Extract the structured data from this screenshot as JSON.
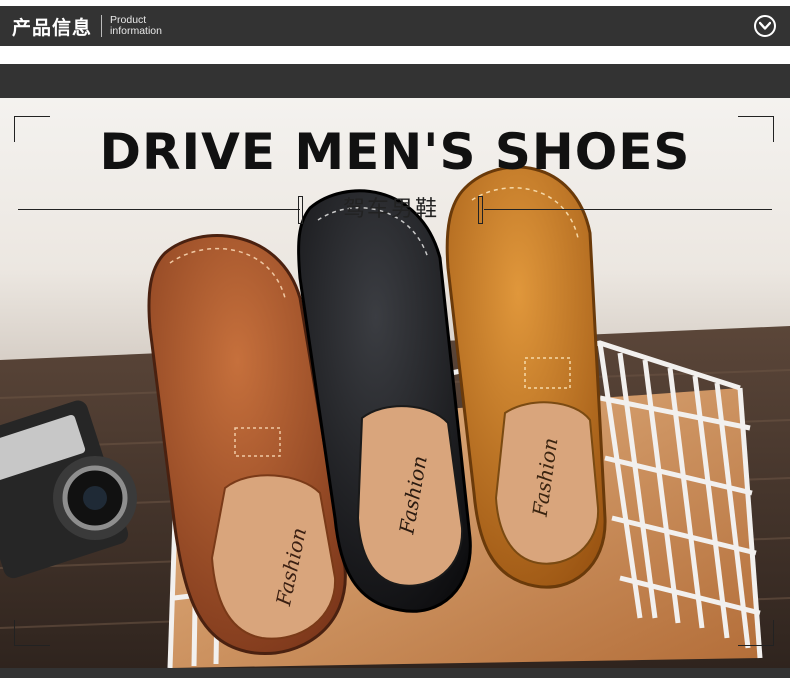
{
  "header": {
    "title_cn": "产品信息",
    "title_en_line1": "Product",
    "title_en_line2": "information",
    "toggle_icon": "chevron-down-circle-icon"
  },
  "banner": {
    "title_en": "DRIVE MEN'S SHOES",
    "title_cn": "驾车男鞋",
    "insole_text": "Fashion"
  },
  "colors": {
    "header_bg": "#333333",
    "shoe_brown": "#a8532a",
    "shoe_black": "#1c1c1e",
    "shoe_yellow": "#c9781f",
    "insole": "#d9a57c",
    "basket": "#f2f0ee"
  }
}
